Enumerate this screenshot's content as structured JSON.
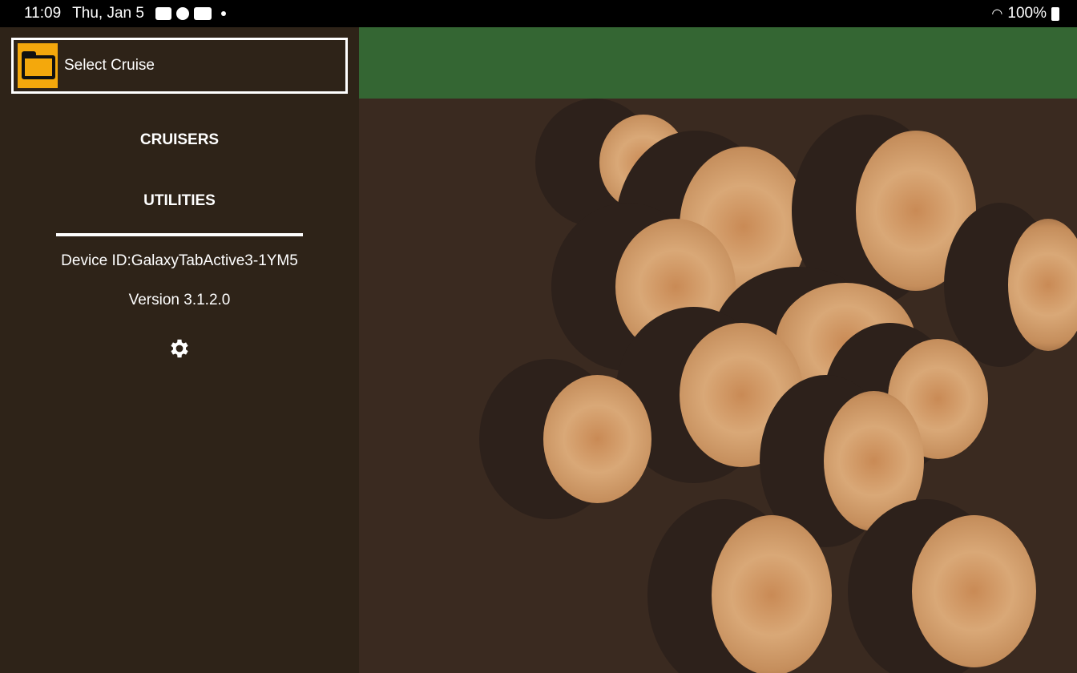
{
  "status_bar": {
    "time": "11:09",
    "date": "Thu, Jan 5",
    "battery": "100%",
    "icons": [
      "notification-icon",
      "app-icon",
      "youtube-icon",
      "dot-icon",
      "wifi-icon",
      "battery-icon"
    ]
  },
  "sidebar": {
    "select_cruise": "Select Cruise",
    "items": [
      {
        "label": "CRUISERS"
      },
      {
        "label": "UTILITIES"
      }
    ],
    "device_id": "Device ID:GalaxyTabActive3-1YM5",
    "version": "Version 3.1.2.0"
  },
  "colors": {
    "sidebar_bg": "#2e2318",
    "header_green": "#346633",
    "folder_accent": "#f4a80c"
  }
}
